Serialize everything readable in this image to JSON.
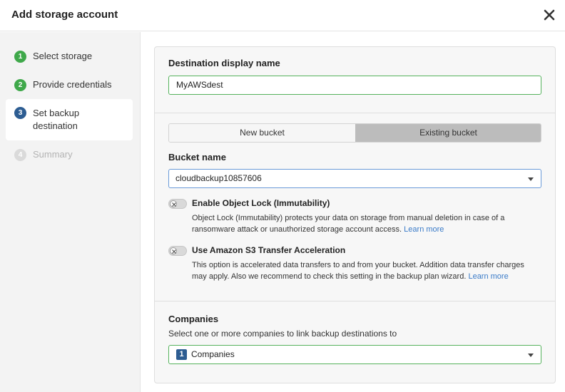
{
  "dialog": {
    "title": "Add storage account"
  },
  "steps": [
    {
      "num": "1",
      "label": "Select storage",
      "state": "done"
    },
    {
      "num": "2",
      "label": "Provide credentials",
      "state": "done"
    },
    {
      "num": "3",
      "label_line1": "Set backup",
      "label_line2": "destination",
      "state": "active"
    },
    {
      "num": "4",
      "label": "Summary",
      "state": "disabled"
    }
  ],
  "destination": {
    "heading": "Destination display name",
    "value": "MyAWSdest"
  },
  "bucket_mode": {
    "options": [
      "New bucket",
      "Existing bucket"
    ],
    "selected": "Existing bucket"
  },
  "bucket": {
    "heading": "Bucket name",
    "value": "cloudbackup10857606"
  },
  "object_lock": {
    "title": "Enable Object Lock (Immutability)",
    "desc_line1": "Object Lock (Immutability) protects your data on storage from manual deletion in case of a",
    "desc_line2": "ransomware attack or unauthorized storage account access.",
    "link": "Learn more",
    "enabled": false
  },
  "transfer_accel": {
    "title": "Use Amazon S3 Transfer Acceleration",
    "desc_line1": "This option is accelerated data transfers to and from your bucket. Addition data transfer charges",
    "desc_line2": "may apply. Also we recommend to check this setting in the backup plan wizard.",
    "link": "Learn more",
    "enabled": false
  },
  "companies": {
    "heading": "Companies",
    "subtitle": "Select one or more companies to link backup destinations to",
    "count": "1",
    "label": "Companies"
  },
  "icons": {
    "close": "close-icon",
    "toggle_off": "x-icon",
    "dropdown": "chevron-down-icon"
  },
  "colors": {
    "accent_green": "#3fa84a",
    "active_step": "#2d5d92",
    "link": "#3a7bc8"
  }
}
